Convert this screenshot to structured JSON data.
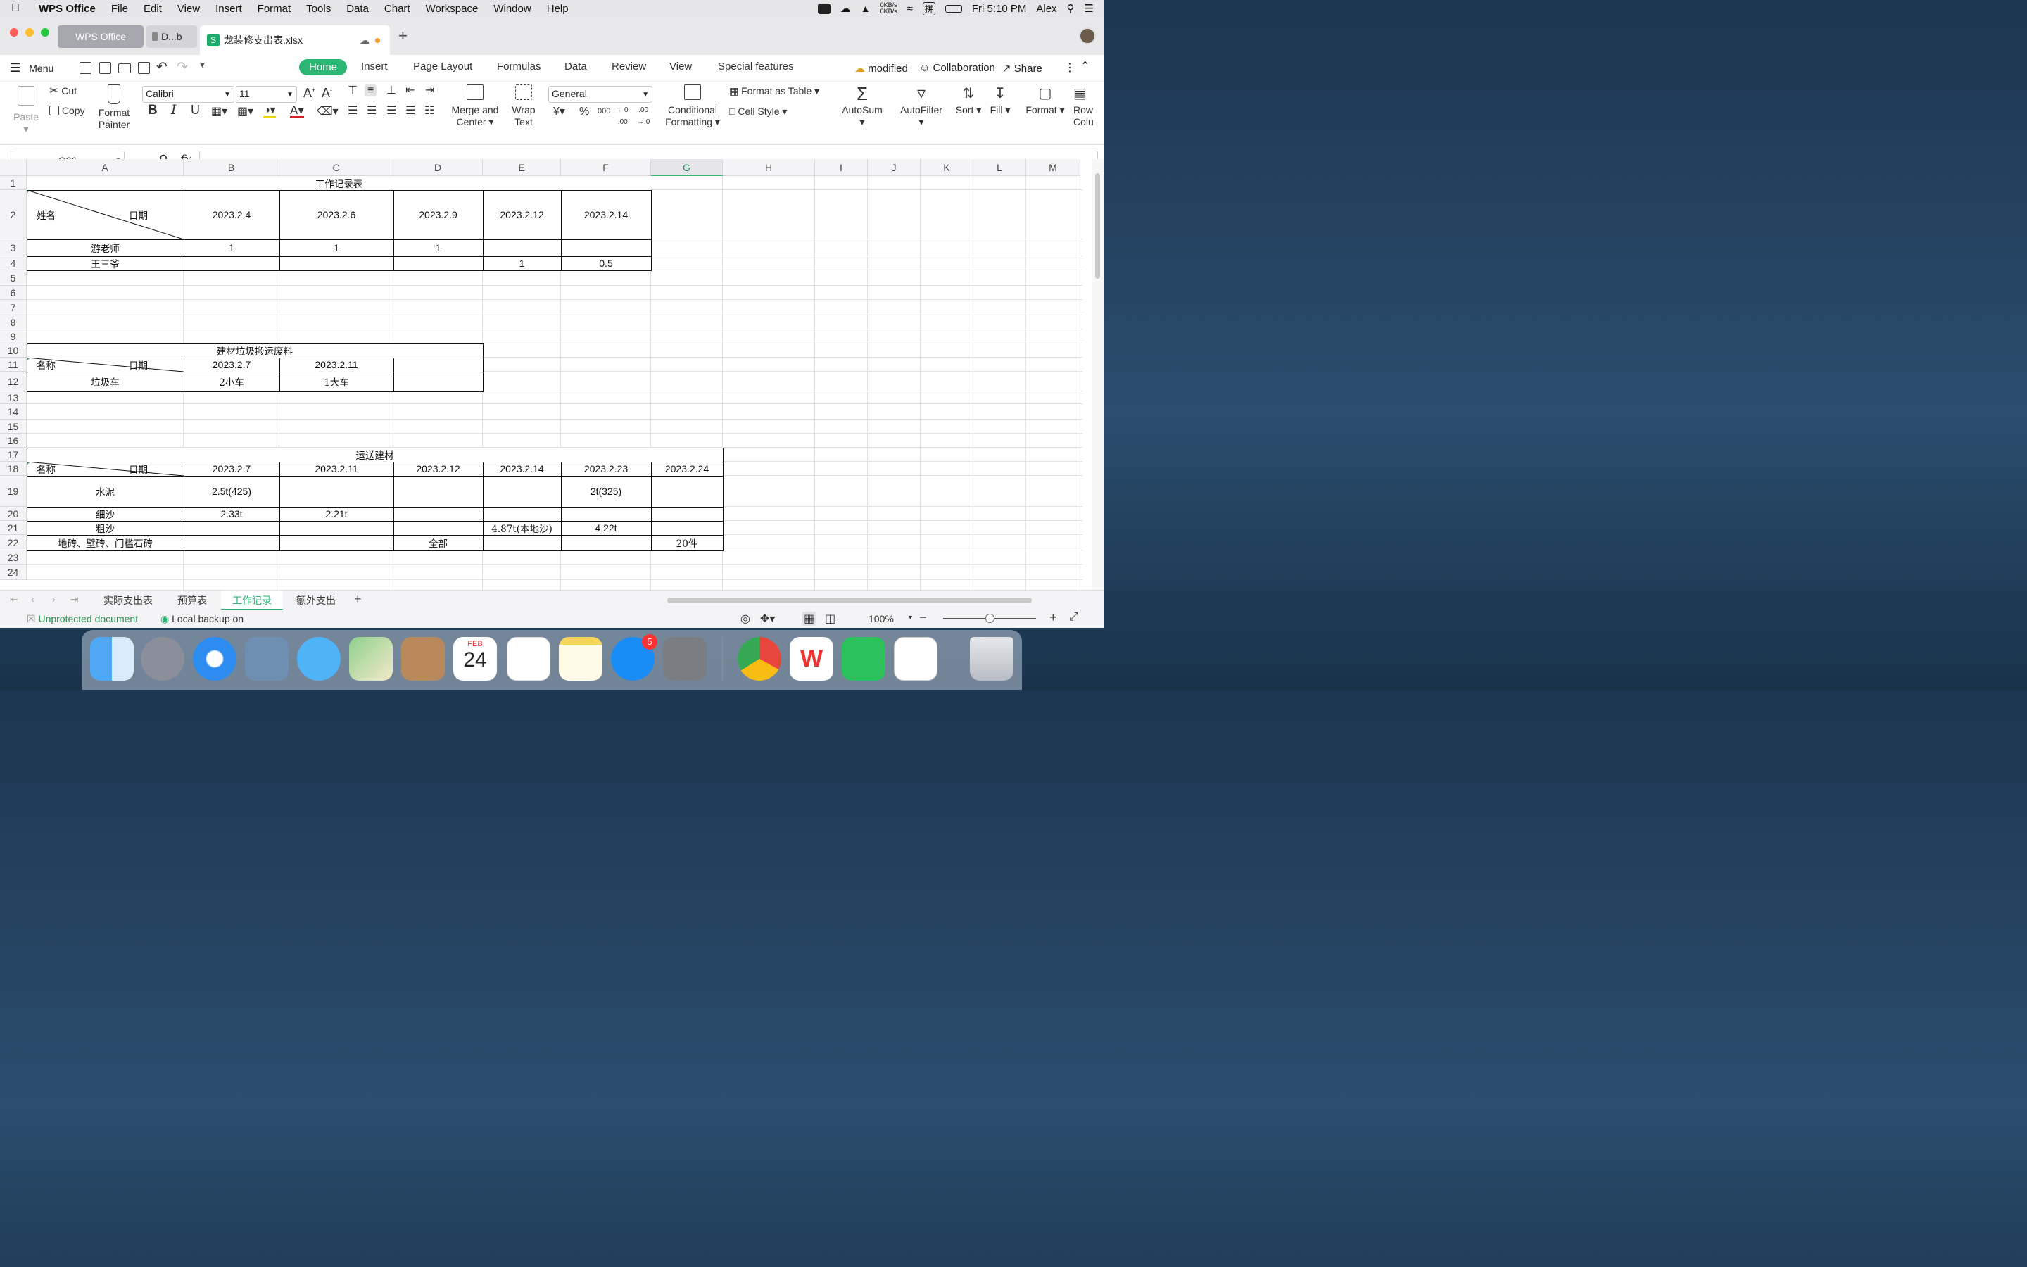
{
  "menubar": {
    "app": "WPS Office",
    "items": [
      "File",
      "Edit",
      "View",
      "Insert",
      "Format",
      "Tools",
      "Data",
      "Chart",
      "Workspace",
      "Window",
      "Help"
    ],
    "net_up": "0KB/s",
    "net_down": "0KB/s",
    "input_method": "拼",
    "clock": "Fri 5:10 PM",
    "user": "Alex"
  },
  "tabs": {
    "wps": "WPS Office",
    "doc": "D...b",
    "file": "龙装修支出表.xlsx"
  },
  "ribbon": {
    "menu": "Menu",
    "tabs": [
      "Home",
      "Insert",
      "Page Layout",
      "Formulas",
      "Data",
      "Review",
      "View",
      "Special features"
    ],
    "modified": "modified",
    "collaboration": "Collaboration",
    "share": "Share"
  },
  "toolbar": {
    "paste": "Paste",
    "cut": "Cut",
    "copy": "Copy",
    "format_painter_1": "Format",
    "format_painter_2": "Painter",
    "font": "Calibri",
    "size": "11",
    "merge_1": "Merge and",
    "merge_2": "Center",
    "wrap_1": "Wrap",
    "wrap_2": "Text",
    "number_format": "General",
    "cond_1": "Conditional",
    "cond_2": "Formatting",
    "format_as_table": "Format as Table",
    "cell_style": "Cell Style",
    "autosum": "AutoSum",
    "autofilter": "AutoFilter",
    "sort": "Sort",
    "fill": "Fill",
    "format": "Format",
    "rows_1": "Rows",
    "rows_2": "Colu"
  },
  "formula_bar": {
    "name_box": "G26",
    "fx": "fx",
    "formula": ""
  },
  "columns": [
    "A",
    "B",
    "C",
    "D",
    "E",
    "F",
    "G",
    "H",
    "I",
    "J",
    "K",
    "L",
    "M"
  ],
  "rows": [
    "1",
    "2",
    "3",
    "4",
    "5",
    "6",
    "7",
    "8",
    "9",
    "10",
    "11",
    "12",
    "13",
    "14",
    "15",
    "16",
    "17",
    "18",
    "19",
    "20",
    "21",
    "22",
    "23",
    "24"
  ],
  "table1": {
    "title": "工作记录表",
    "corner_row": "姓名",
    "corner_col": "日期",
    "dates": [
      "2023.2.4",
      "2023.2.6",
      "2023.2.9",
      "2023.2.12",
      "2023.2.14"
    ],
    "rows": [
      {
        "name": "游老师",
        "values": [
          "1",
          "1",
          "1",
          "",
          ""
        ]
      },
      {
        "name": "王三爷",
        "values": [
          "",
          "",
          "",
          "1",
          "0.5"
        ]
      }
    ]
  },
  "table2": {
    "title": "建材垃圾搬运废料",
    "corner_row": "名称",
    "corner_col": "日期",
    "dates": [
      "2023.2.7",
      "2023.2.11",
      ""
    ],
    "rows": [
      {
        "name": "垃圾车",
        "values": [
          "2小车",
          "1大车",
          ""
        ]
      }
    ]
  },
  "table3": {
    "title": "运送建材",
    "corner_row": "名称",
    "corner_col": "日期",
    "dates": [
      "2023.2.7",
      "2023.2.11",
      "2023.2.12",
      "2023.2.14",
      "2023.2.23",
      "2023.2.24"
    ],
    "rows": [
      {
        "name": "水泥",
        "values": [
          "2.5t(425)",
          "",
          "",
          "",
          "2t(325)",
          ""
        ]
      },
      {
        "name": "细沙",
        "values": [
          "2.33t",
          "2.21t",
          "",
          "",
          "",
          ""
        ]
      },
      {
        "name": "粗沙",
        "values": [
          "",
          "",
          "",
          "4.87t(本地沙)",
          "4.22t",
          ""
        ]
      },
      {
        "name": "地砖、壁砖、门槛石砖",
        "values": [
          "",
          "",
          "全部",
          "",
          "",
          "20件"
        ]
      }
    ]
  },
  "sheets": [
    "实际支出表",
    "预算表",
    "工作记录",
    "额外支出"
  ],
  "active_sheet": "工作记录",
  "status": {
    "protection": "Unprotected document",
    "backup": "Local backup on",
    "zoom": "100%"
  },
  "dock": {
    "calendar_month": "FEB",
    "calendar_day": "24",
    "appstore_badge": "5"
  },
  "colors": {
    "accent": "#2bb673",
    "selected_col": "#2bb673"
  }
}
